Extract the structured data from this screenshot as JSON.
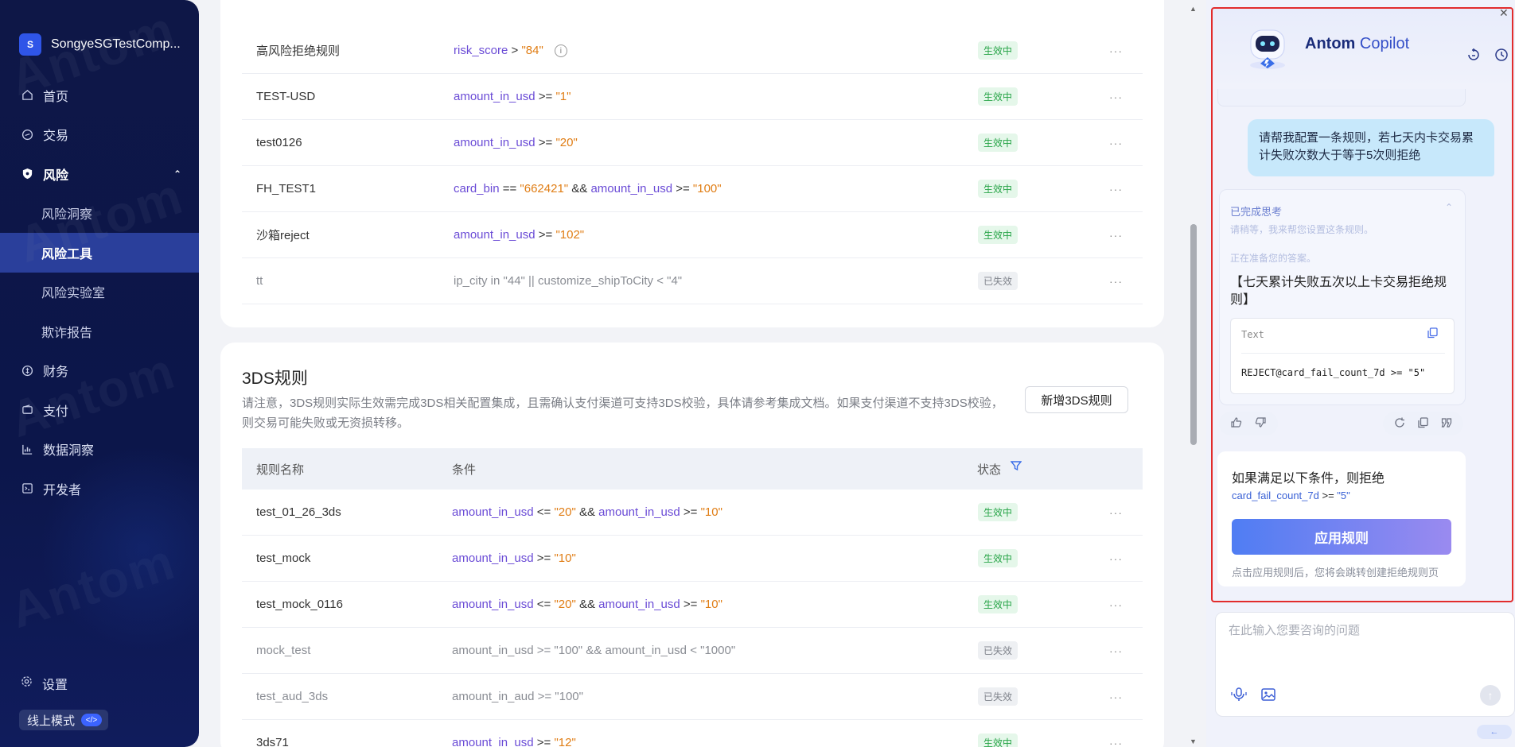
{
  "app": {
    "company": "SongyeSGTestComp...",
    "logo_letter": "S",
    "watermark": "Antom"
  },
  "sidebar": {
    "items": [
      {
        "label": "首页",
        "icon": "home-icon"
      },
      {
        "label": "交易",
        "icon": "transaction-icon"
      },
      {
        "label": "风险",
        "icon": "shield-icon"
      },
      {
        "label": "风险洞察"
      },
      {
        "label": "风险工具"
      },
      {
        "label": "风险实验室"
      },
      {
        "label": "欺诈报告"
      },
      {
        "label": "财务",
        "icon": "finance-icon"
      },
      {
        "label": "支付",
        "icon": "wallet-icon"
      },
      {
        "label": "数据洞察",
        "icon": "chart-icon"
      },
      {
        "label": "开发者",
        "icon": "code-icon"
      }
    ],
    "settings": "设置",
    "mode": "线上模式",
    "mode_badge": "</>"
  },
  "rules_top": [
    {
      "name": "高风险拒绝规则",
      "cond": [
        [
          "v",
          "risk_score"
        ],
        [
          "o",
          " > "
        ],
        [
          "s",
          "\"84\""
        ]
      ],
      "status": "生效中",
      "active": true,
      "info": true
    },
    {
      "name": "TEST-USD",
      "cond": [
        [
          "v",
          "amount_in_usd"
        ],
        [
          "o",
          " >= "
        ],
        [
          "s",
          "\"1\""
        ]
      ],
      "status": "生效中",
      "active": true
    },
    {
      "name": "test0126",
      "cond": [
        [
          "v",
          "amount_in_usd"
        ],
        [
          "o",
          " >= "
        ],
        [
          "s",
          "\"20\""
        ]
      ],
      "status": "生效中",
      "active": true
    },
    {
      "name": "FH_TEST1",
      "cond": [
        [
          "v",
          "card_bin"
        ],
        [
          "o",
          " == "
        ],
        [
          "s",
          "\"662421\""
        ],
        [
          "o",
          " && "
        ],
        [
          "v",
          "amount_in_usd"
        ],
        [
          "o",
          " >= "
        ],
        [
          "s",
          "\"100\""
        ]
      ],
      "status": "生效中",
      "active": true
    },
    {
      "name": "沙箱reject",
      "cond": [
        [
          "v",
          "amount_in_usd"
        ],
        [
          "o",
          " >= "
        ],
        [
          "s",
          "\"102\""
        ]
      ],
      "status": "生效中",
      "active": true
    },
    {
      "name": "tt",
      "cond": [
        [
          "o",
          "ip_city in \"44\" || customize_shipToCity < \"4\""
        ]
      ],
      "status": "已失效",
      "active": false
    }
  ],
  "threeds": {
    "title": "3DS规则",
    "desc": "请注意，3DS规则实际生效需完成3DS相关配置集成，且需确认支付渠道可支持3DS校验，具体请参考集成文档。如果支付渠道不支持3DS校验，则交易可能失败或无资损转移。",
    "new_button": "新增3DS规则",
    "headers": {
      "name": "规则名称",
      "cond": "条件",
      "status": "状态"
    },
    "rules": [
      {
        "name": "test_01_26_3ds",
        "cond": [
          [
            "v",
            "amount_in_usd"
          ],
          [
            "o",
            " <= "
          ],
          [
            "s",
            "\"20\""
          ],
          [
            "o",
            " && "
          ],
          [
            "v",
            "amount_in_usd"
          ],
          [
            "o",
            " >= "
          ],
          [
            "s",
            "\"10\""
          ]
        ],
        "status": "生效中",
        "active": true
      },
      {
        "name": "test_mock",
        "cond": [
          [
            "v",
            "amount_in_usd"
          ],
          [
            "o",
            " >= "
          ],
          [
            "s",
            "\"10\""
          ]
        ],
        "status": "生效中",
        "active": true
      },
      {
        "name": "test_mock_0116",
        "cond": [
          [
            "v",
            "amount_in_usd"
          ],
          [
            "o",
            " <= "
          ],
          [
            "s",
            "\"20\""
          ],
          [
            "o",
            " && "
          ],
          [
            "v",
            "amount_in_usd"
          ],
          [
            "o",
            " >= "
          ],
          [
            "s",
            "\"10\""
          ]
        ],
        "status": "生效中",
        "active": true
      },
      {
        "name": "mock_test",
        "cond": [
          [
            "o",
            "amount_in_usd >= \"100\" && amount_in_usd < \"1000\""
          ]
        ],
        "status": "已失效",
        "active": false
      },
      {
        "name": "test_aud_3ds",
        "cond": [
          [
            "o",
            "amount_in_aud >= \"100\""
          ]
        ],
        "status": "已失效",
        "active": false
      },
      {
        "name": "3ds71",
        "cond": [
          [
            "v",
            "amount_in_usd"
          ],
          [
            "o",
            " >= "
          ],
          [
            "s",
            "\"12\""
          ]
        ],
        "status": "生效中",
        "active": true
      }
    ]
  },
  "copilot": {
    "title_bold": "Antom",
    "title_rest": " Copilot",
    "user_message": "请帮我配置一条规则，若七天内卡交易累计失败次数大于等于5次则拒绝",
    "thinking_done": "已完成思考",
    "thinking_1": "请稍等，我来帮您设置这条规则。",
    "thinking_2": "正在准备您的答案。",
    "rule_title": "【七天累计失败五次以上卡交易拒绝规则】",
    "code_label": "Text",
    "code": "REJECT@card_fail_count_7d >= \"5\"",
    "rec_title": "如果满足以下条件，则拒绝",
    "rec_var": "card_fail_count_7d",
    "rec_op": " >= ",
    "rec_val": "\"5\"",
    "apply_button": "应用规则",
    "apply_note": "点击应用规则后，您将会跳转创建拒绝规则页",
    "input_placeholder": "在此输入您要咨询的问题"
  }
}
